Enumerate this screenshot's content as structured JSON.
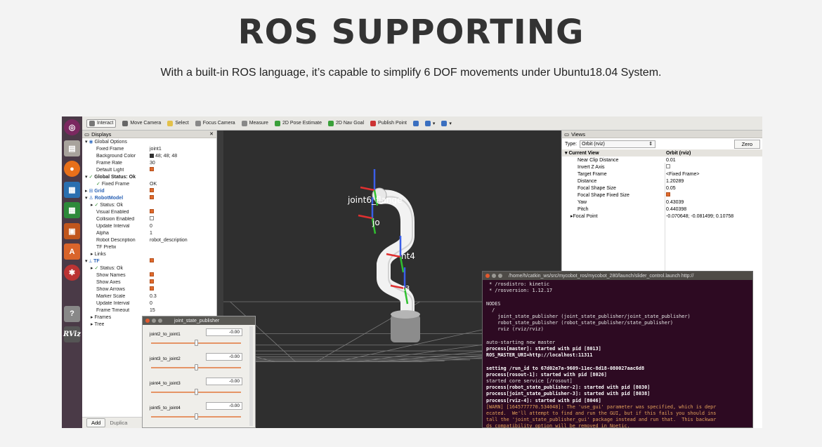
{
  "page": {
    "title": "ROS SUPPORTING",
    "subtitle": "With a built-in ROS language, it’s capable to simplify 6 DOF movements under Ubuntu18.04 System."
  },
  "colors": {
    "accent_orange": "#e06a2c",
    "terminal_bg": "#2d0a22",
    "launcher_bg": "#4a3a47",
    "viewport_bg": "#2f2f2f"
  },
  "launcher": [
    {
      "name": "ubuntu-icon",
      "glyph": "◎"
    },
    {
      "name": "files-icon",
      "glyph": "▤"
    },
    {
      "name": "firefox-icon",
      "glyph": "●"
    },
    {
      "name": "writer-icon",
      "glyph": "▦"
    },
    {
      "name": "calc-icon",
      "glyph": "▦"
    },
    {
      "name": "impress-icon",
      "glyph": "▣"
    },
    {
      "name": "software-icon",
      "glyph": "A"
    },
    {
      "name": "settings-icon",
      "glyph": "✱"
    },
    {
      "name": "terminal-icon",
      "glyph": ">_"
    },
    {
      "name": "help-icon",
      "glyph": "?"
    },
    {
      "name": "rviz-icon",
      "glyph": "RViz"
    }
  ],
  "toolbar": [
    {
      "label": "Interact",
      "active": true,
      "color": "#777"
    },
    {
      "label": "Move Camera",
      "color": "#666"
    },
    {
      "label": "Select",
      "color": "#e3c14a"
    },
    {
      "label": "Focus Camera",
      "color": "#888"
    },
    {
      "label": "Measure",
      "color": "#888"
    },
    {
      "label": "2D Pose Estimate",
      "color": "#3aa03a"
    },
    {
      "label": "2D Nav Goal",
      "color": "#3aa03a"
    },
    {
      "label": "Publish Point",
      "color": "#c33"
    },
    {
      "label": "",
      "color": "#3a6fc0"
    },
    {
      "label": "▾",
      "color": "#3a6fc0"
    },
    {
      "label": "▾",
      "color": "#3a6fc0"
    }
  ],
  "displays": {
    "title": "Displays",
    "rows": [
      {
        "indent": 0,
        "arrow": "▾",
        "icon": "globe",
        "key": "Global Options",
        "style": ""
      },
      {
        "indent": 2,
        "key": "Fixed Frame",
        "value": "joint1"
      },
      {
        "indent": 2,
        "key": "Background Color",
        "value": "48; 48; 48",
        "swatch": true
      },
      {
        "indent": 2,
        "key": "Frame Rate",
        "value": "30"
      },
      {
        "indent": 2,
        "key": "Default Light",
        "check": "on"
      },
      {
        "indent": 0,
        "arrow": "▾",
        "tick": true,
        "key": "Global Status: Ok",
        "style": "bold"
      },
      {
        "indent": 2,
        "tick": true,
        "key": "Fixed Frame",
        "value": "OK"
      },
      {
        "indent": 0,
        "arrow": "▸",
        "icon": "grid",
        "key": "Grid",
        "style": "blue",
        "check": "on"
      },
      {
        "indent": 0,
        "arrow": "▾",
        "icon": "robot",
        "key": "RobotModel",
        "style": "blue",
        "check": "on"
      },
      {
        "indent": 1,
        "arrow": "▸",
        "tick": true,
        "key": "Status: Ok",
        "style": ""
      },
      {
        "indent": 2,
        "key": "Visual Enabled",
        "check": "on"
      },
      {
        "indent": 2,
        "key": "Collision Enabled",
        "check": "off"
      },
      {
        "indent": 2,
        "key": "Update Interval",
        "value": "0"
      },
      {
        "indent": 2,
        "key": "Alpha",
        "value": "1"
      },
      {
        "indent": 2,
        "key": "Robot Description",
        "value": "robot_description"
      },
      {
        "indent": 2,
        "key": "TF Prefix",
        "value": ""
      },
      {
        "indent": 1,
        "arrow": "▸",
        "key": "Links"
      },
      {
        "indent": 0,
        "arrow": "▾",
        "icon": "tf",
        "key": "TF",
        "style": "blue",
        "check": "on"
      },
      {
        "indent": 1,
        "arrow": "▸",
        "tick": true,
        "key": "Status: Ok",
        "style": ""
      },
      {
        "indent": 2,
        "key": "Show Names",
        "check": "on"
      },
      {
        "indent": 2,
        "key": "Show Axes",
        "check": "on"
      },
      {
        "indent": 2,
        "key": "Show Arrows",
        "check": "on"
      },
      {
        "indent": 2,
        "key": "Marker Scale",
        "value": "0.3"
      },
      {
        "indent": 2,
        "key": "Update Interval",
        "value": "0"
      },
      {
        "indent": 2,
        "key": "Frame Timeout",
        "value": "15"
      },
      {
        "indent": 1,
        "arrow": "▸",
        "key": "Frames"
      },
      {
        "indent": 1,
        "arrow": "▸",
        "key": "Tree"
      }
    ],
    "add_label": "Add",
    "dup_label": "Duplica"
  },
  "viewport": {
    "labels": [
      "joint6_flange",
      "jo",
      "nt4",
      "t3"
    ]
  },
  "views": {
    "title": "Views",
    "type_label": "Type:",
    "type_value": "Orbit (rviz)",
    "zero_label": "Zero",
    "header_key": "Current View",
    "header_value": "Orbit (rviz)",
    "rows": [
      {
        "key": "Near Clip Distance",
        "value": "0.01"
      },
      {
        "key": "Invert Z Axis",
        "check": "off"
      },
      {
        "key": "Target Frame",
        "value": "<Fixed Frame>"
      },
      {
        "key": "Distance",
        "value": "1.20289"
      },
      {
        "key": "Focal Shape Size",
        "value": "0.05"
      },
      {
        "key": "Focal Shape Fixed Size",
        "check": "on"
      },
      {
        "key": "Yaw",
        "value": "0.43039"
      },
      {
        "key": "Pitch",
        "value": "0.440398"
      },
      {
        "key": "Focal Point",
        "value": "-0.070648; -0.081499; 0.10758",
        "arrow": "▸"
      }
    ]
  },
  "jsp": {
    "title": "joint_state_publisher",
    "joints": [
      {
        "name": "joint2_to_joint1",
        "value": "-0.00",
        "level": 0.5
      },
      {
        "name": "joint3_to_joint2",
        "value": "-0.00",
        "level": 0.5
      },
      {
        "name": "joint4_to_joint3",
        "value": "-0.00",
        "level": 0.5
      },
      {
        "name": "joint5_to_joint4",
        "value": "-0.00",
        "level": 0.5
      }
    ]
  },
  "terminal": {
    "title": "/home/h/catkin_ws/src/mycobot_ros/mycobot_280/launch/slider_control.launch http://",
    "lines": [
      {
        "t": " * /rosdistro: kinetic",
        "s": ""
      },
      {
        "t": " * /rosversion: 1.12.17",
        "s": ""
      },
      {
        "t": "",
        "s": ""
      },
      {
        "t": "NODES",
        "s": ""
      },
      {
        "t": "  /",
        "s": ""
      },
      {
        "t": "    joint_state_publisher (joint_state_publisher/joint_state_publisher)",
        "s": ""
      },
      {
        "t": "    robot_state_publisher (robot_state_publisher/state_publisher)",
        "s": ""
      },
      {
        "t": "    rviz (rviz/rviz)",
        "s": ""
      },
      {
        "t": "",
        "s": ""
      },
      {
        "t": "auto-starting new master",
        "s": ""
      },
      {
        "t": "process[master]: started with pid [8013]",
        "s": "b"
      },
      {
        "t": "ROS_MASTER_URI=http://localhost:11311",
        "s": "b"
      },
      {
        "t": "",
        "s": ""
      },
      {
        "t": "setting /run_id to 67d02e7a-9609-11ec-8d18-080027aac6d8",
        "s": "b"
      },
      {
        "t": "process[rosout-1]: started with pid [8026]",
        "s": "b"
      },
      {
        "t": "started core service [/rosout]",
        "s": ""
      },
      {
        "t": "process[robot_state_publisher-2]: started with pid [8030]",
        "s": "b"
      },
      {
        "t": "process[joint_state_publisher-3]: started with pid [8038]",
        "s": "b"
      },
      {
        "t": "process[rviz-4]: started with pid [8046]",
        "s": "b"
      },
      {
        "t": "[WARN] [1645777770.534048]: The 'use_gui' parameter was specified, which is depr",
        "s": "w"
      },
      {
        "t": "ecated.  We'll attempt to find and run the GUI, but if this fails you should ins",
        "s": "w"
      },
      {
        "t": "tall the 'joint_state_publisher_gui' package instead and run that.  This backwar",
        "s": "w"
      },
      {
        "t": "ds compatibility option will be removed in Noetic.",
        "s": "w"
      }
    ]
  }
}
